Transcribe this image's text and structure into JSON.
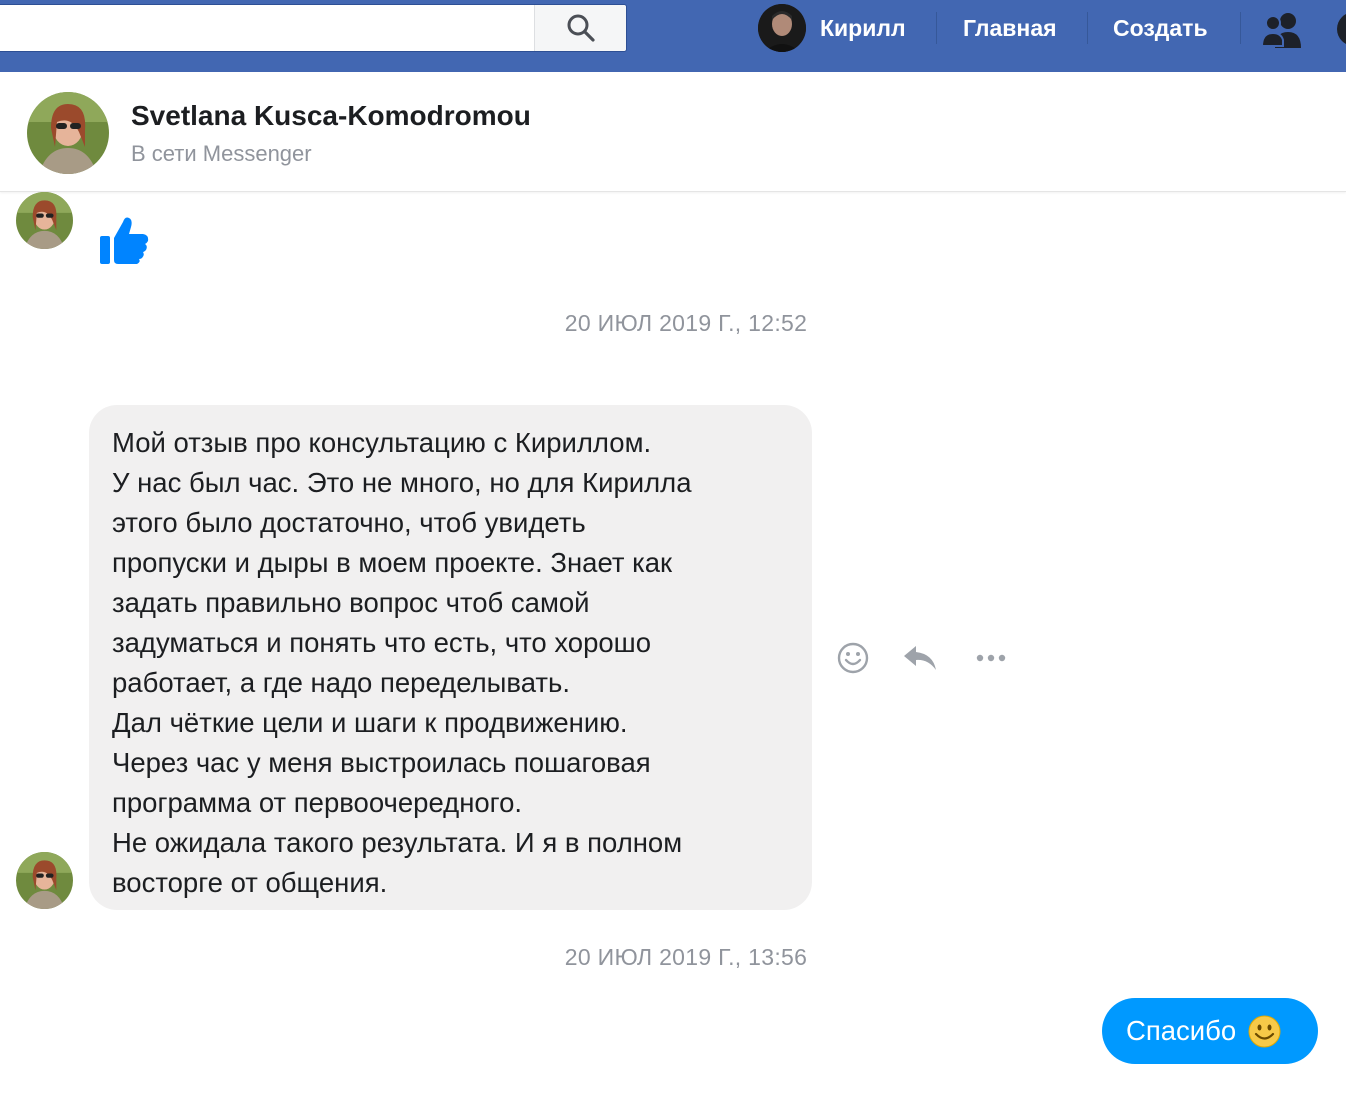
{
  "topbar": {
    "search_placeholder": "",
    "user_name": "Кирилл",
    "nav_home": "Главная",
    "nav_create": "Создать",
    "icons": [
      "search-icon",
      "friends-icon",
      "messenger-icon"
    ],
    "brand_color": "#4267b2"
  },
  "conversation": {
    "name": "Svetlana Kusca-Komodromou",
    "status": "В сети Messenger"
  },
  "messages": {
    "like_icon": "thumbs-up-icon",
    "timestamp_1": "20 ИЮЛ 2019 Г., 12:52",
    "review_lines": [
      "Мой отзыв про консультацию с Кириллом.",
      "У нас был час. Это не много, но для Кирилла",
      "этого было достаточно, чтоб увидеть",
      "пропуски и дыры в моем проекте. Знает как",
      "задать правильно вопрос чтоб самой",
      "задуматься и понять что есть, что хорошо",
      "работает, а где надо переделывать.",
      "Дал чёткие цели и шаги к продвижению.",
      "Через час у меня выстроилась пошаговая",
      "программа от первоочередного.",
      "Не ожидала такого результата. И я в полном",
      "восторге от общения."
    ],
    "message_actions": [
      "smile-react-icon",
      "reply-icon",
      "more-icon"
    ],
    "timestamp_2": "20 ИЮЛ 2019 Г., 13:56",
    "reply_text": "Спасибо",
    "reply_emoji": "smiling-face-emoji",
    "outgoing_color": "#0099ff",
    "incoming_color": "#f1f0f0"
  }
}
